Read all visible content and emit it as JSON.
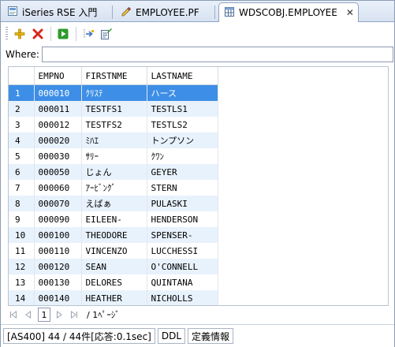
{
  "tabs": [
    {
      "label": "iSeries RSE 入門",
      "icon": "rse-page-icon",
      "active": false
    },
    {
      "label": "EMPLOYEE.PF",
      "icon": "pencil-file-icon",
      "active": false
    },
    {
      "label": "WDSCOBJ.EMPLOYEE",
      "icon": "table-grid-icon",
      "active": true
    }
  ],
  "close_symbol": "✕",
  "toolbar": {
    "icons": [
      "add-row-icon",
      "delete-row-icon",
      "run-icon",
      "export-icon",
      "edit-properties-icon"
    ],
    "colors": {
      "add": "#e8b400",
      "delete": "#d8271b",
      "run": "#2e9a2e"
    }
  },
  "where": {
    "label": "Where:",
    "value": ""
  },
  "table": {
    "columns": [
      "",
      "EMPNO",
      "FIRSTNME",
      "LASTNAME"
    ],
    "rows": [
      [
        "1",
        "000010",
        "ｸﾘｽﾃ",
        "ハース"
      ],
      [
        "2",
        "000011",
        "TESTFS1",
        "TESTLS1"
      ],
      [
        "3",
        "000012",
        "TESTFS2",
        "TESTLS2"
      ],
      [
        "4",
        "000020",
        "ﾐﾊｴ",
        "トンプソン"
      ],
      [
        "5",
        "000030",
        "ｻﾘｰ",
        "ｸﾜﾝ"
      ],
      [
        "6",
        "000050",
        "じょん",
        "GEYER"
      ],
      [
        "7",
        "000060",
        "ｱｰﾋﾞﾝｸﾞ",
        "STERN"
      ],
      [
        "8",
        "000070",
        "えばぁ",
        "PULASKI"
      ],
      [
        "9",
        "000090",
        "EILEEN-",
        "HENDERSON"
      ],
      [
        "10",
        "000100",
        "THEODORE",
        "SPENSER-"
      ],
      [
        "11",
        "000110",
        "VINCENZO",
        "LUCCHESSI"
      ],
      [
        "12",
        "000120",
        "SEAN",
        "O'CONNELL"
      ],
      [
        "13",
        "000130",
        "DELORES",
        "QUINTANA"
      ],
      [
        "14",
        "000140",
        "HEATHER",
        "NICHOLLS"
      ]
    ],
    "selected_row": 0,
    "selection_color": "#3d8ee6",
    "alt_row_color": "#e8f2fd"
  },
  "paging": {
    "current_page": "1",
    "page_info": "/ 1ﾍﾟｰｼﾞ",
    "buttons": [
      "first-page-icon",
      "prev-page-icon",
      "next-page-icon",
      "last-page-icon"
    ]
  },
  "status": {
    "summary": "[AS400] 44 / 44件[応答:0.1sec]",
    "ddl": "DDL",
    "definition": "定義情報"
  }
}
